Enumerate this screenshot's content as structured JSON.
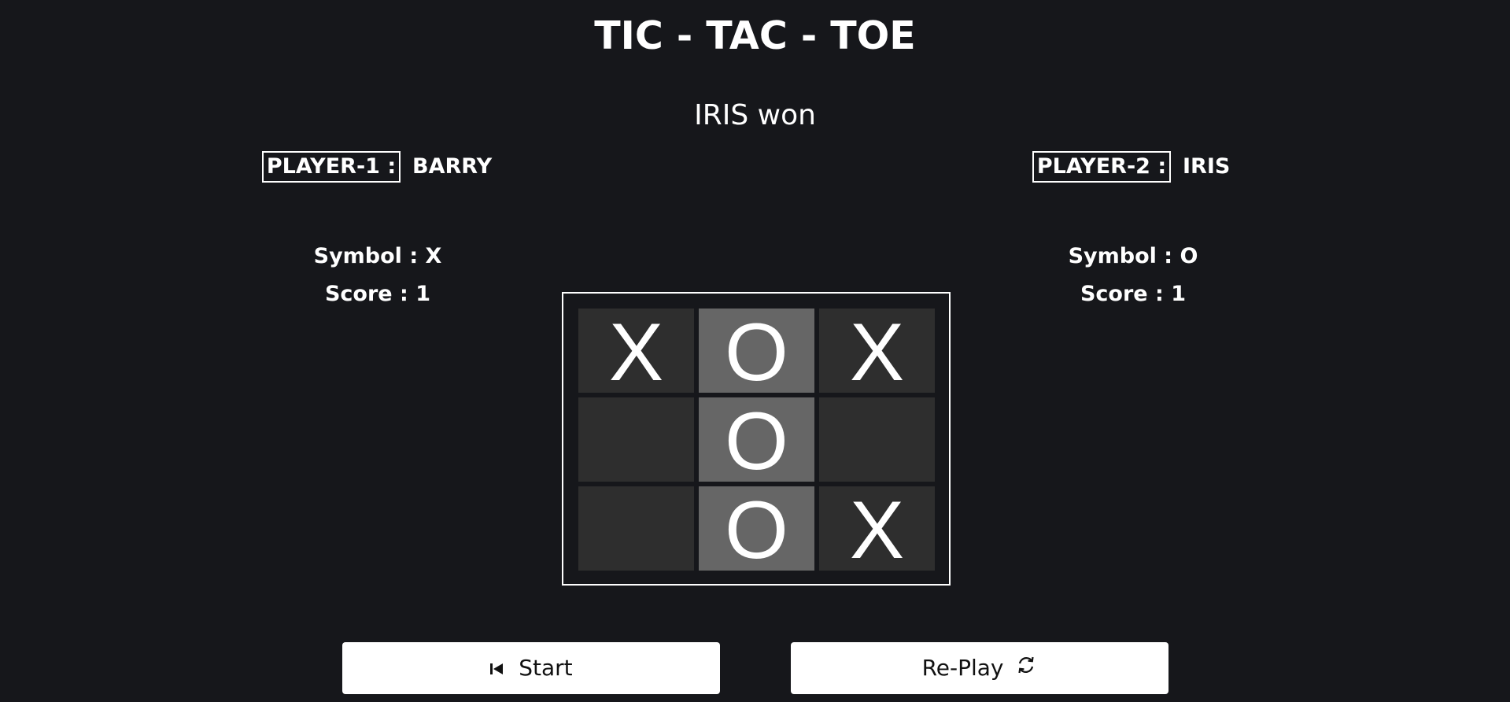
{
  "title": "TIC - TAC - TOE",
  "status": "IRIS won",
  "player1": {
    "tag": "PLAYER-1 :",
    "name": "BARRY",
    "symbol_text": "Symbol : X",
    "score_text": "Score : 1"
  },
  "player2": {
    "tag": "PLAYER-2 :",
    "name": "IRIS",
    "symbol_text": "Symbol : O",
    "score_text": "Score : 1"
  },
  "board": {
    "cells": [
      "X",
      "O",
      "X",
      "",
      "O",
      "",
      "",
      "O",
      "X"
    ],
    "winning_cells": [
      1,
      4,
      7
    ],
    "colors": {
      "cell": "#2e2e2e",
      "winning_cell": "#666666"
    }
  },
  "buttons": {
    "start_label": "Start",
    "start_icon": "skip-back-icon",
    "replay_label": "Re-Play",
    "replay_icon": "refresh-icon"
  },
  "colors": {
    "background": "#16171b",
    "text": "#ffffff",
    "button_bg": "#ffffff",
    "button_text": "#111111"
  }
}
